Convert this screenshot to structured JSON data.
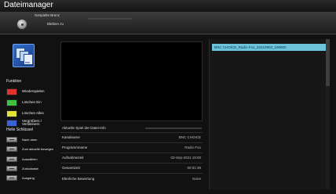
{
  "app": {
    "title": "Dateimanager"
  },
  "header": {
    "played_label": "Gespielte Brenz",
    "played_progress": 0,
    "remaining_label": "Bleiben zu"
  },
  "sidebar": {
    "thumbnail_tag": "rec",
    "functions_title": "Funktion",
    "color_actions": [
      {
        "label": "Wiederspielen",
        "color": "#e53030"
      },
      {
        "label": "Löschen Ein",
        "color": "#3fc23f"
      },
      {
        "label": "Löschen Alles",
        "color": "#e3e03a"
      },
      {
        "label": "Vergrößern / Verkleinern",
        "color": "#3a62d8"
      }
    ],
    "keys_title": "Helle Schlüssel",
    "key_actions": [
      {
        "label": "Nach oben"
      },
      {
        "label": "Zum aktuelle bewegen"
      },
      {
        "label": "Auswählen"
      },
      {
        "label": "Zurücktaste"
      },
      {
        "label": "Ausgang"
      }
    ]
  },
  "info": {
    "current_time_label": "Aktuelle Spiel der Datei-Info",
    "current_progress": 0,
    "rows": [
      {
        "key": "Kanalname",
        "value": "BNC CHOICE"
      },
      {
        "key": "Programmname",
        "value": "Radio Foo"
      },
      {
        "key": "Aufnahmezeit",
        "value": "03-Sep-2021 19:00"
      },
      {
        "key": "Gesamtzeit",
        "value": "00:01:39"
      },
      {
        "key": "Elterliche Bewertung",
        "value": "None"
      }
    ]
  },
  "file_list": {
    "items": [
      "BNC CHOICE_Radio Foo_20210903_190000"
    ],
    "selected_index": 0
  }
}
